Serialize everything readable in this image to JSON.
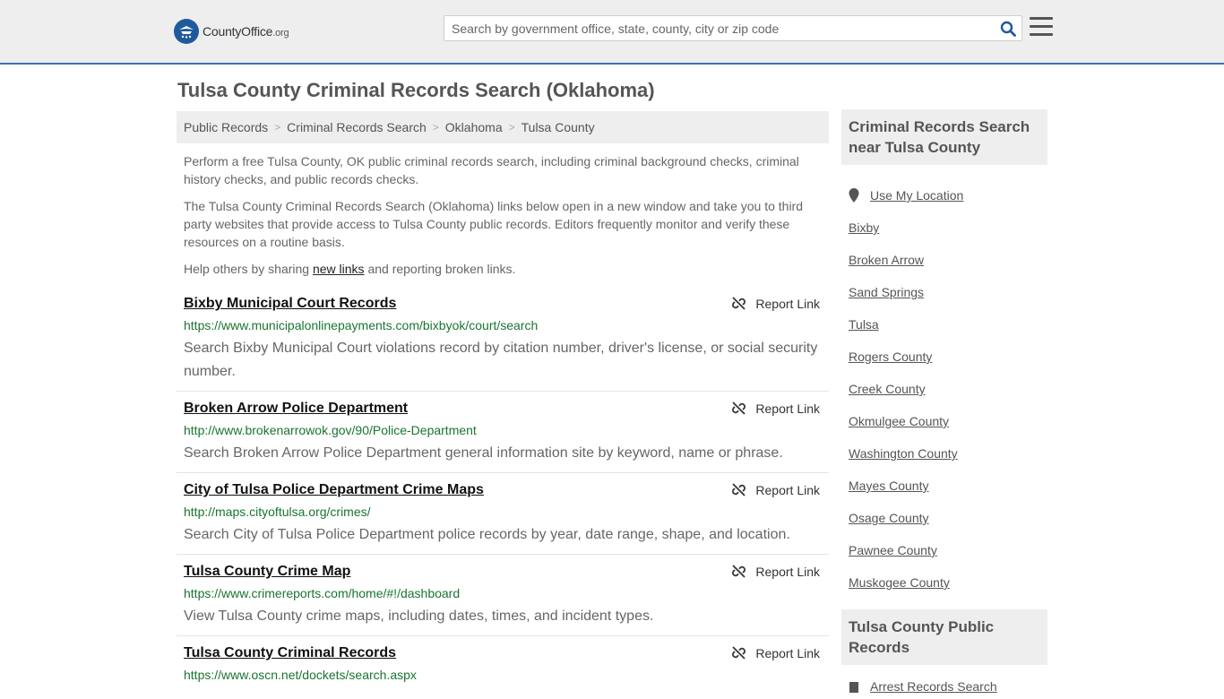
{
  "header": {
    "logo_name": "CountyOffice",
    "logo_tld": ".org",
    "search_placeholder": "Search by government office, state, county, city or zip code"
  },
  "page": {
    "title": "Tulsa County Criminal Records Search (Oklahoma)"
  },
  "breadcrumb": [
    "Public Records",
    "Criminal Records Search",
    "Oklahoma",
    "Tulsa County"
  ],
  "intro": {
    "p1": "Perform a free Tulsa County, OK public criminal records search, including criminal background checks, criminal history checks, and public records checks.",
    "p2": "The Tulsa County Criminal Records Search (Oklahoma) links below open in a new window and take you to third party websites that provide access to Tulsa County public records. Editors frequently monitor and verify these resources on a routine basis.",
    "p3_before": "Help others by sharing ",
    "p3_link": "new links",
    "p3_after": " and reporting broken links."
  },
  "report_label": "Report Link",
  "listings": [
    {
      "title": "Bixby Municipal Court Records",
      "url": "https://www.municipalonlinepayments.com/bixbyok/court/search",
      "desc": "Search Bixby Municipal Court violations record by citation number, driver's license, or social security number."
    },
    {
      "title": "Broken Arrow Police Department",
      "url": "http://www.brokenarrowok.gov/90/Police-Department",
      "desc": "Search Broken Arrow Police Department general information site by keyword, name or phrase."
    },
    {
      "title": "City of Tulsa Police Department Crime Maps",
      "url": "http://maps.cityoftulsa.org/crimes/",
      "desc": "Search City of Tulsa Police Department police records by year, date range, shape, and location."
    },
    {
      "title": "Tulsa County Crime Map",
      "url": "https://www.crimereports.com/home/#!/dashboard",
      "desc": "View Tulsa County crime maps, including dates, times, and incident types."
    },
    {
      "title": "Tulsa County Criminal Records",
      "url": "https://www.oscn.net/dockets/search.aspx",
      "desc": ""
    }
  ],
  "sidebar": {
    "box1_title": "Criminal Records Search near Tulsa County",
    "use_location": "Use My Location",
    "links": [
      "Bixby",
      "Broken Arrow",
      "Sand Springs",
      "Tulsa",
      "Rogers County",
      "Creek County",
      "Okmulgee County",
      "Washington County",
      "Mayes County",
      "Osage County",
      "Pawnee County",
      "Muskogee County"
    ],
    "box2_title": "Tulsa County Public Records",
    "box2_first_link": "Arrest Records Search"
  },
  "colors": {
    "accent": "#3d74b3",
    "url_green": "#197530",
    "logo_blue": "#1f5a9c",
    "search_icon": "#1f5a9c"
  },
  "icons": {
    "search": "search-icon",
    "menu": "hamburger-menu-icon",
    "report": "broken-link-icon",
    "location": "map-pin-icon"
  }
}
